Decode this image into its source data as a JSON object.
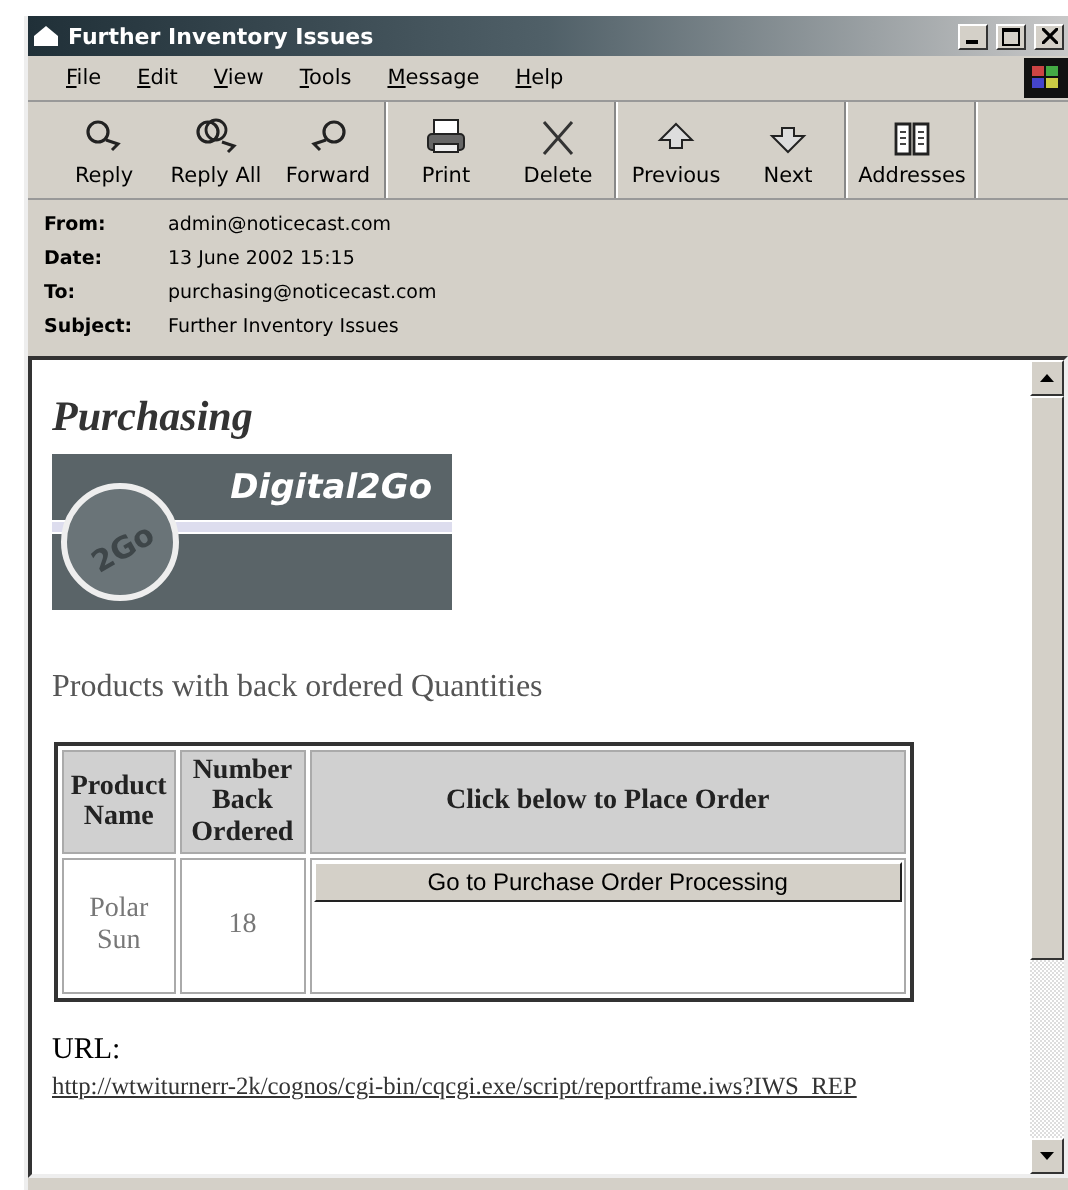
{
  "window": {
    "title": "Further Inventory Issues"
  },
  "menu": [
    "File",
    "Edit",
    "View",
    "Tools",
    "Message",
    "Help"
  ],
  "toolbar": {
    "groups": [
      [
        {
          "label": "Reply"
        },
        {
          "label": "Reply All"
        },
        {
          "label": "Forward"
        }
      ],
      [
        {
          "label": "Print"
        },
        {
          "label": "Delete"
        }
      ],
      [
        {
          "label": "Previous"
        },
        {
          "label": "Next"
        }
      ],
      [
        {
          "label": "Addresses"
        }
      ]
    ]
  },
  "headers": [
    {
      "label": "From:",
      "value": "admin@noticecast.com"
    },
    {
      "label": "Date:",
      "value": "13 June 2002 15:15"
    },
    {
      "label": "To:",
      "value": "purchasing@noticecast.com"
    },
    {
      "label": "Subject:",
      "value": "Further Inventory Issues"
    }
  ],
  "message": {
    "heading": "Purchasing",
    "logo": {
      "name": "Digital2Go",
      "badge": "2Go"
    },
    "section_title": "Products with back ordered Quantities",
    "table": {
      "columns": [
        "Product Name",
        "Number Back Ordered",
        "Click below to Place Order"
      ],
      "rows": [
        {
          "product": "Polar Sun",
          "quantity": "18",
          "button": "Go to Purchase Order Processing"
        }
      ]
    },
    "url_label": "URL:",
    "url": "http://wtwiturnerr-2k/cognos/cgi-bin/cqcgi.exe/script/reportframe.iws?IWS_REP"
  }
}
